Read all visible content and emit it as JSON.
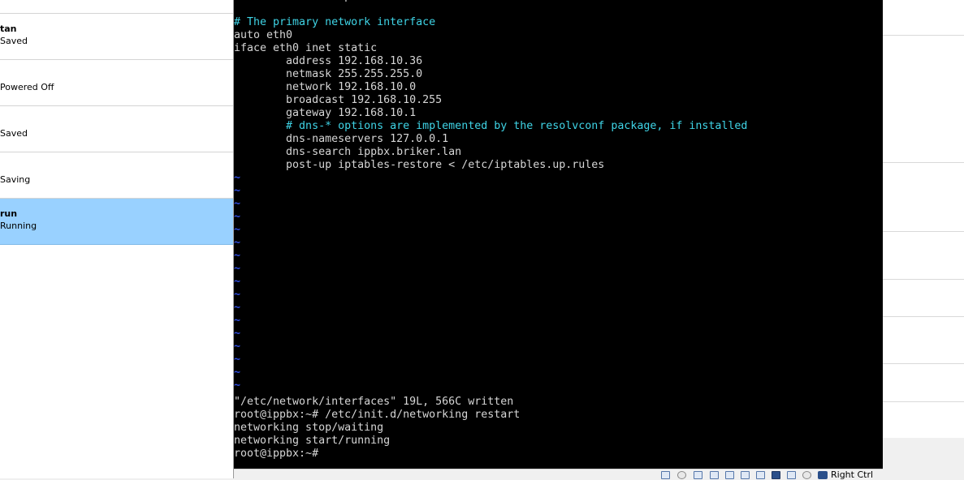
{
  "vm_list": [
    {
      "name": "tan",
      "state": "Saved",
      "selected": false
    },
    {
      "name": "",
      "state": "Powered Off",
      "selected": false
    },
    {
      "name": "",
      "state": "Saved",
      "selected": false
    },
    {
      "name": "",
      "state": "Saving",
      "selected": false
    },
    {
      "name": "run",
      "state": "Running",
      "selected": true
    }
  ],
  "terminal": {
    "lines": [
      {
        "text": "iface lo inet loopback",
        "style": "normal"
      },
      {
        "text": "",
        "style": "normal"
      },
      {
        "text": "# The primary network interface",
        "style": "comment"
      },
      {
        "text": "auto eth0",
        "style": "normal"
      },
      {
        "text": "iface eth0 inet static",
        "style": "normal"
      },
      {
        "text": "        address 192.168.10.36",
        "style": "normal"
      },
      {
        "text": "        netmask 255.255.255.0",
        "style": "normal"
      },
      {
        "text": "        network 192.168.10.0",
        "style": "normal"
      },
      {
        "text": "        broadcast 192.168.10.255",
        "style": "normal"
      },
      {
        "text": "        gateway 192.168.10.1",
        "style": "normal"
      },
      {
        "text": "        # dns-* options are implemented by the resolvconf package, if installed",
        "style": "comment"
      },
      {
        "text": "        dns-nameservers 127.0.0.1",
        "style": "normal"
      },
      {
        "text": "        dns-search ippbx.briker.lan",
        "style": "normal"
      },
      {
        "text": "        post-up iptables-restore < /etc/iptables.up.rules",
        "style": "normal"
      }
    ],
    "tilde_char": "~",
    "tilde_count": 17,
    "bottom_lines": [
      "\"/etc/network/interfaces\" 19L, 566C written",
      "root@ippbx:~# /etc/init.d/networking restart",
      "networking stop/waiting",
      "networking start/running",
      "root@ippbx:~#"
    ]
  },
  "statusbar": {
    "icons": [
      "hard-disk-icon",
      "optical-drive-icon",
      "usb-icon",
      "network-icon",
      "shared-folder-icon",
      "display-icon",
      "video-capture-icon",
      "cpu-icon",
      "mouse-integration-icon",
      "host-key-icon"
    ],
    "host_key_label": "Right Ctrl"
  },
  "colors": {
    "terminal_bg": "#000000",
    "terminal_text": "#d6d6d6",
    "comment": "#3fd4e6",
    "tilde": "#2f4de0",
    "selection": "#99d1ff"
  }
}
